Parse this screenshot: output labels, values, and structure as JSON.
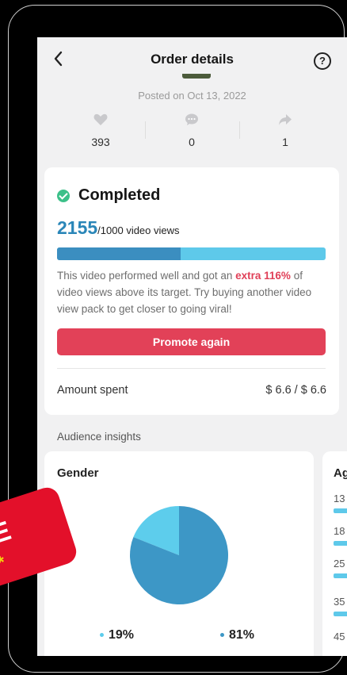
{
  "header": {
    "back_icon": "chevron-left-icon",
    "title": "Order details",
    "help_icon": "question-circle-icon"
  },
  "post": {
    "posted_on": "Posted on Oct 13, 2022"
  },
  "stats": [
    {
      "icon": "heart-icon",
      "value": "393"
    },
    {
      "icon": "comment-icon",
      "value": "0"
    },
    {
      "icon": "share-arrow-icon",
      "value": "1"
    }
  ],
  "order": {
    "status": "Completed",
    "views_achieved": "2155",
    "views_target": "/1000 video views",
    "progress_fraction": 0.46,
    "desc_before": "This video performed well and got an ",
    "desc_highlight": "extra 116%",
    "desc_after": " of video views above its target. Try buying another video view pack to get closer to going viral!",
    "promote_label": "Promote again",
    "amount_label": "Amount spent",
    "amount_value": "$ 6.6 / $ 6.6"
  },
  "insights": {
    "section_label": "Audience insights",
    "gender": {
      "title": "Gender",
      "segments": [
        {
          "percent_label": "19%",
          "fraction": 0.19,
          "color": "#5dcdec"
        },
        {
          "percent_label": "81%",
          "fraction": 0.81,
          "color": "#3d97c6"
        }
      ]
    },
    "age": {
      "title": "Ag",
      "rows": [
        "13",
        "18",
        "25",
        "35",
        "45"
      ]
    }
  },
  "overlay": {
    "sticker_text": "CE",
    "sticker_stars": "***"
  },
  "colors": {
    "accent_red": "#e24158",
    "success_green": "#3cc089",
    "views_blue": "#2a86b8",
    "bar_dark": "#3b8ec0",
    "bar_light": "#5ec9ea"
  }
}
